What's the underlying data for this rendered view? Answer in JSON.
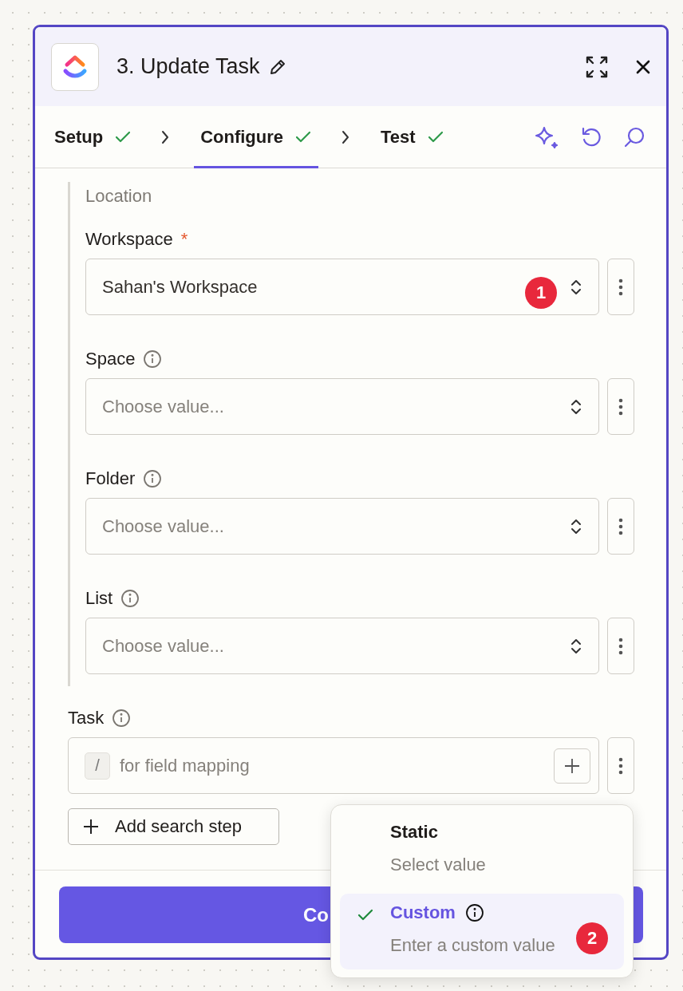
{
  "header": {
    "title": "3. Update Task"
  },
  "steps": [
    {
      "label": "Setup",
      "done": true,
      "selected": false
    },
    {
      "label": "Configure",
      "done": true,
      "selected": true
    },
    {
      "label": "Test",
      "done": true,
      "selected": false
    }
  ],
  "location": {
    "heading": "Location",
    "fields": [
      {
        "label": "Workspace",
        "required_mark": "*",
        "info": false,
        "value": "Sahan's Workspace",
        "badge": "1"
      },
      {
        "label": "Space",
        "info": true,
        "placeholder": "Choose value..."
      },
      {
        "label": "Folder",
        "info": true,
        "placeholder": "Choose value..."
      },
      {
        "label": "List",
        "info": true,
        "placeholder": "Choose value..."
      }
    ]
  },
  "task": {
    "label": "Task",
    "info": true,
    "key_hint": "/",
    "placeholder": "for field mapping"
  },
  "add_search_step": "Add search step",
  "continue_button": "Co",
  "mode_menu": {
    "options": [
      {
        "title": "Static",
        "subtitle": "Select value",
        "selected": false,
        "info": false
      },
      {
        "title": "Custom",
        "subtitle": "Enter a custom value",
        "selected": true,
        "info": true,
        "badge": "2"
      }
    ]
  }
}
